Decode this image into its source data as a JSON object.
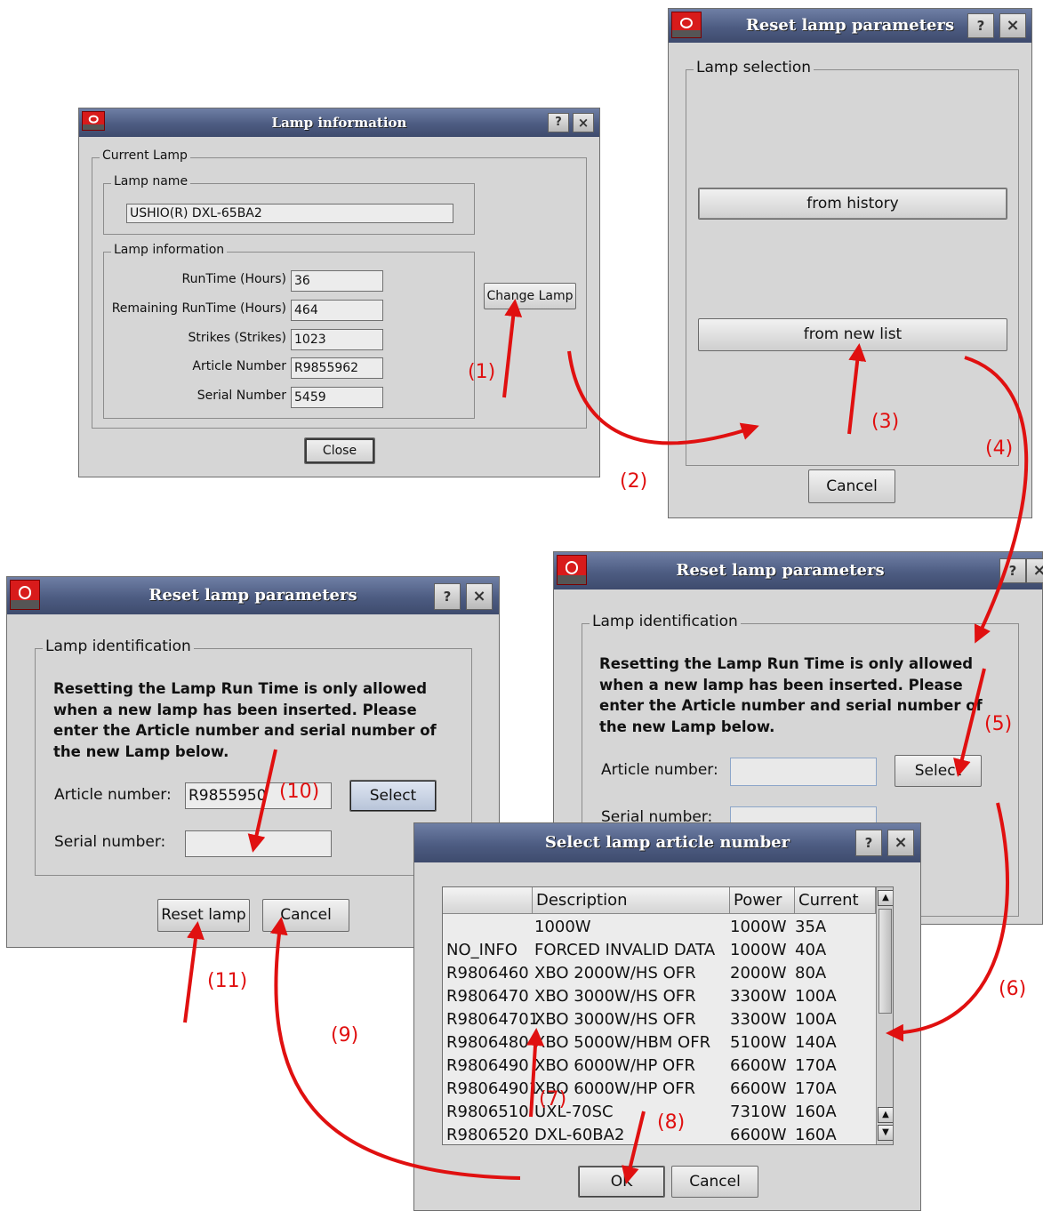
{
  "lamp_info": {
    "title": "Lamp information",
    "help_label": "?",
    "close_x": "×",
    "current_lamp": "Current Lamp",
    "lamp_name_group": "Lamp name",
    "lamp_name": "USHIO(R) DXL-65BA2",
    "lamp_info_group": "Lamp information",
    "fields": [
      {
        "label": "RunTime  (Hours)",
        "value": "36"
      },
      {
        "label": "Remaining RunTime  (Hours)",
        "value": "464"
      },
      {
        "label": "Strikes  (Strikes)",
        "value": "1023"
      },
      {
        "label": "Article Number",
        "value": "R9855962"
      },
      {
        "label": "Serial Number",
        "value": "5459"
      }
    ],
    "change_lamp": "Change Lamp",
    "close": "Close"
  },
  "reset_selection": {
    "title": "Reset lamp parameters",
    "help_label": "?",
    "close_x": "×",
    "group": "Lamp selection",
    "from_history": "from history",
    "from_new_list": "from new list",
    "cancel": "Cancel"
  },
  "reset_ident_right": {
    "title": "Reset lamp parameters",
    "help_label": "?",
    "close_x": "×",
    "group": "Lamp identification",
    "message": "Resetting the Lamp Run Time is only allowed when a new lamp has been inserted. Please enter the Article number and serial number of the new Lamp below.",
    "article_label": "Article number:",
    "article_value": "",
    "serial_label": "Serial number:",
    "select": "Select"
  },
  "reset_ident_left": {
    "title": "Reset lamp parameters",
    "help_label": "?",
    "close_x": "×",
    "group": "Lamp identification",
    "message": "Resetting the Lamp Run Time is only allowed when a new lamp has been inserted. Please enter the Article number and serial number of the new Lamp below.",
    "article_label": "Article number:",
    "article_value": "R9855950",
    "serial_label": "Serial number:",
    "serial_value": "",
    "select": "Select",
    "reset_lamp": "Reset lamp",
    "cancel": "Cancel"
  },
  "select_article": {
    "title": "Select lamp article number",
    "help_label": "?",
    "close_x": "×",
    "columns": [
      "",
      "Description",
      "Power",
      "Current"
    ],
    "rows": [
      {
        "article": "",
        "description": "1000W",
        "power": "1000W",
        "current": "35A"
      },
      {
        "article": "NO_INFO",
        "description": "FORCED INVALID DATA",
        "power": "1000W",
        "current": "40A"
      },
      {
        "article": "R9806460",
        "description": "XBO 2000W/HS OFR",
        "power": "2000W",
        "current": "80A"
      },
      {
        "article": "R9806470",
        "description": "XBO 3000W/HS OFR",
        "power": "3300W",
        "current": "100A"
      },
      {
        "article": "R98064701",
        "description": "XBO 3000W/HS OFR",
        "power": "3300W",
        "current": "100A"
      },
      {
        "article": "R9806480",
        "description": "XBO 5000W/HBM OFR",
        "power": "5100W",
        "current": "140A"
      },
      {
        "article": "R9806490",
        "description": "XBO 6000W/HP OFR",
        "power": "6600W",
        "current": "170A"
      },
      {
        "article": "R98064901",
        "description": "XBO 6000W/HP OFR",
        "power": "6600W",
        "current": "170A"
      },
      {
        "article": "R9806510",
        "description": "UXL-70SC",
        "power": "7310W",
        "current": "160A"
      },
      {
        "article": "R9806520",
        "description": "DXL-60BA2",
        "power": "6600W",
        "current": "160A"
      }
    ],
    "ok": "OK",
    "cancel": "Cancel"
  },
  "annotations": [
    "(1)",
    "(2)",
    "(3)",
    "(4)",
    "(5)",
    "(6)",
    "(7)",
    "(8)",
    "(9)",
    "(10)",
    "(11)"
  ],
  "colors": {
    "annotation": "#e01010",
    "titlebar": "#4d5c82",
    "dialog_bg": "#d6d6d6"
  }
}
